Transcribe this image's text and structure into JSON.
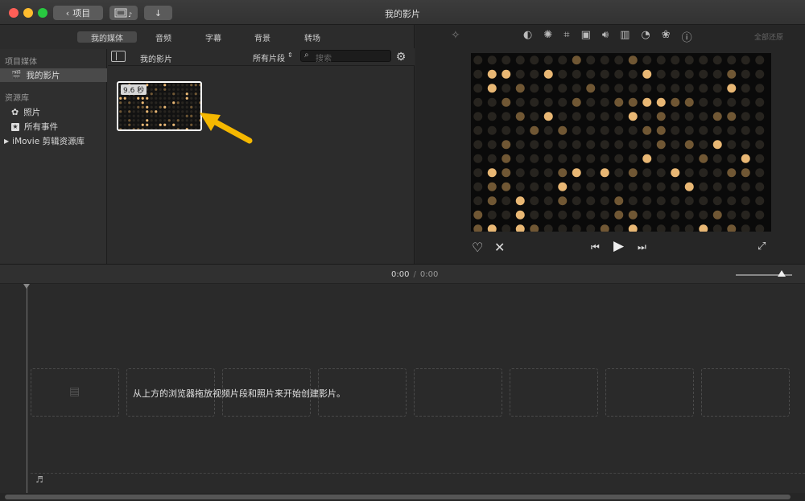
{
  "window": {
    "title": "我的影片"
  },
  "toolbar": {
    "back_label": "项目",
    "download_icon": "↓"
  },
  "media_tabs": [
    {
      "label": "我的媒体",
      "active": true
    },
    {
      "label": "音频",
      "active": false
    },
    {
      "label": "字幕",
      "active": false
    },
    {
      "label": "背景",
      "active": false
    },
    {
      "label": "转场",
      "active": false
    }
  ],
  "sidebar": {
    "project_media_header": "项目媒体",
    "project_item": "我的影片",
    "libraries_header": "资源库",
    "photos": "照片",
    "all_events": "所有事件",
    "library": "iMovie 剪辑资源库"
  },
  "library_bar": {
    "title": "我的影片",
    "filter": "所有片段",
    "search_placeholder": "搜索"
  },
  "clip": {
    "duration": "9.6 秒"
  },
  "viewer": {
    "restore_all": "全部还原"
  },
  "timeline": {
    "current_time": "0:00",
    "separator": "/",
    "total_time": "0:00",
    "empty_hint": "从上方的浏览器拖放视频片段和照片来开始创建影片。"
  },
  "colors": {
    "accent_arrow": "#f5b800",
    "selected": "#4a4a4a"
  }
}
